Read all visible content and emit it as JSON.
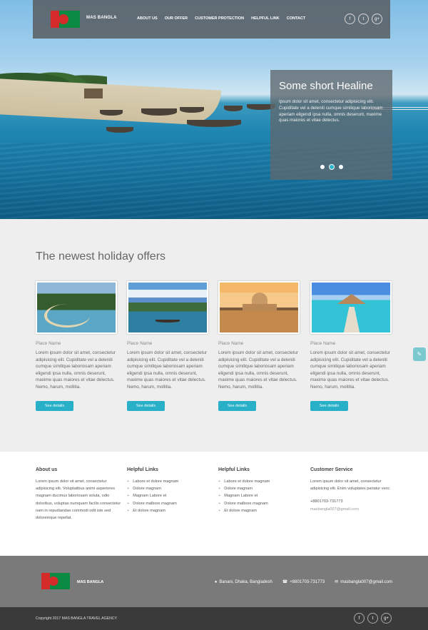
{
  "brand": {
    "name": "MAS BANGLA"
  },
  "nav": {
    "links": [
      "ABOUT US",
      "OUR OFFER",
      "CUSTOMER PROTECTION",
      "HELPFUL LINK",
      "CONTACT"
    ]
  },
  "social": [
    "f",
    "t",
    "g+"
  ],
  "hero": {
    "headline": "Some short Healine",
    "text": "Ipsum dolor sit amet, consectetur adipisicing elit. Cupiditate vel a deleniti cumque similique laboriosam aperiam eligendi ipsa nulla, omnis deserunt, maxime quas maiores et vitae delectus.",
    "active_slide": 2,
    "slides": 3
  },
  "offers": {
    "title": "The newest holiday offers",
    "cards": [
      {
        "place": "Place Name",
        "text": "Lorem ipsum dolor sit amet, consectetur adipisicing elit. Cupiditate vel a deleniti cumque similique laboriosam aperiam eligendi ipsa nulla, omnis deserunt, maxime quas maiores et vitae delectus. Nemo, harum, mollitia.",
        "button": "See details"
      },
      {
        "place": "Place Name",
        "text": "Lorem ipsum dolor sit amet, consectetur adipisicing elit. Cupiditate vel a deleniti cumque similique laboriosam aperiam eligendi ipsa nulla, omnis deserunt, maxime quas maiores et vitae delectus. Nemo, harum, mollitia.",
        "button": "See details"
      },
      {
        "place": "Place Name",
        "text": "Lorem ipsum dolor sit amet, consectetur adipisicing elit. Cupiditate vel a deleniti cumque similique laboriosam aperiam eligendi ipsa nulla, omnis deserunt, maxime quas maiores et vitae delectus. Nemo, harum, mollitia.",
        "button": "See details"
      },
      {
        "place": "Place Name",
        "text": "Lorem ipsum dolor sit amet, consectetur adipisicing elit. Cupiditate vel a deleniti cumque similique laboriosam aperiam eligendi ipsa nulla, omnis deserunt, maxime quas maiores et vitae delectus. Nemo, harum, mollitia.",
        "button": "See details"
      }
    ]
  },
  "footer_links": {
    "about": {
      "title": "About us",
      "text": "Lorem ipsum dolor sit amet, consectetur adipisicing elit. Voluptatibus animi asperiores magnam ducimus laboriosam soluta, odio doloribus, voluptas numquam facilis consectetur nam in repudiandae commodi odit iste sed doloremque repellat."
    },
    "helpful1": {
      "title": "Helpful Links",
      "items": [
        "Labore et dolore magnam",
        "Dolore magnam",
        "Magnam Labore et",
        "Dolore malbore magnam",
        "Et dolore magnam"
      ]
    },
    "helpful2": {
      "title": "Helpful Links",
      "items": [
        "Labore et dolore magnam",
        "Dolore magnam",
        "Magnam Labore et",
        "Dolore malbore magnam",
        "Et dolore magnam"
      ]
    },
    "service": {
      "title": "Customer Service",
      "text": "Lorem ipsum dolor sit amet, consectetur adipisicing elit. Enim voluptates pariatur vero.",
      "phone": "+8801703-731773",
      "email": "masbangla007@gmail.com"
    }
  },
  "contact_bar": {
    "brand": "MAS BANGLA",
    "address": "Banani, Dhaka, Bangladesh",
    "phone": "+8801703-731773",
    "email": "masbangla007@gmail.com"
  },
  "bottom": {
    "copyright": "Copyright 2017 MAS BANGLA TRAVEL AGENCY"
  },
  "colors": {
    "accent": "#27b0c7",
    "flag_green": "#0a8a43",
    "flag_red": "#d42a2a"
  }
}
